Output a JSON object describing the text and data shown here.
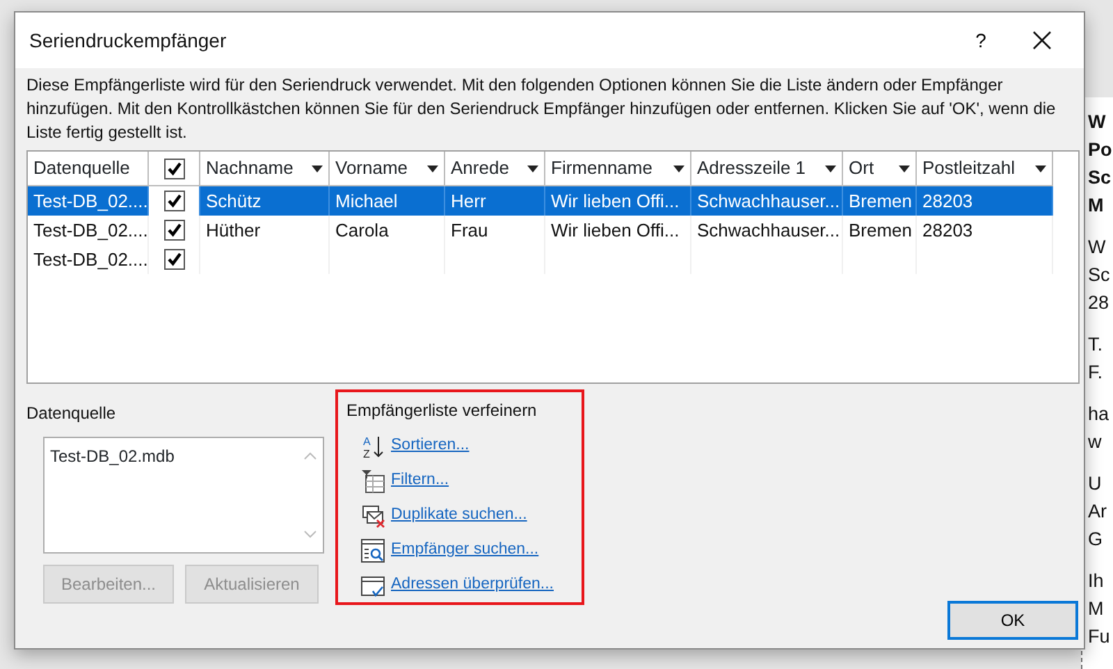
{
  "window": {
    "title": "Seriendruckempfänger",
    "help": "?"
  },
  "description": "Diese Empfängerliste wird für den Seriendruck verwendet. Mit den folgenden Optionen können Sie die Liste ändern oder Empfänger hinzufügen. Mit den Kontrollkästchen können Sie für den Seriendruck Empfänger hinzufügen oder entfernen. Klicken Sie auf 'OK', wenn die Liste fertig gestellt ist.",
  "table": {
    "columns": [
      {
        "label": "Datenquelle",
        "kind": "text"
      },
      {
        "label": "Nachname",
        "kind": "filter"
      },
      {
        "label": "Vorname",
        "kind": "filter"
      },
      {
        "label": "Anrede",
        "kind": "filter"
      },
      {
        "label": "Firmenname",
        "kind": "filter"
      },
      {
        "label": "Adresszeile 1",
        "kind": "filter"
      },
      {
        "label": "Ort",
        "kind": "filter"
      },
      {
        "label": "Postleitzahl",
        "kind": "filter"
      }
    ],
    "check_column": {
      "checked": true
    },
    "rows": [
      {
        "selected": true,
        "checked": true,
        "cells": [
          "Test-DB_02....",
          "Schütz",
          "Michael",
          "Herr",
          "Wir lieben Offi...",
          "Schwachhauser...",
          "Bremen",
          "28203"
        ]
      },
      {
        "selected": false,
        "checked": true,
        "cells": [
          "Test-DB_02....",
          "Hüther",
          "Carola",
          "Frau",
          "Wir lieben Offi...",
          "Schwachhauser...",
          "Bremen",
          "28203"
        ]
      },
      {
        "selected": false,
        "checked": true,
        "cells": [
          "Test-DB_02....",
          "",
          "",
          "",
          "",
          "",
          "",
          ""
        ]
      }
    ]
  },
  "data_source": {
    "label": "Datenquelle",
    "items": [
      "Test-DB_02.mdb"
    ],
    "buttons": [
      {
        "label": "Bearbeiten...",
        "disabled": true
      },
      {
        "label": "Aktualisieren",
        "disabled": true
      }
    ]
  },
  "refine": {
    "label": "Empfängerliste verfeinern",
    "links": [
      {
        "kind": "sort",
        "label": "Sortieren...",
        "icon_letters": [
          "A",
          "Z"
        ]
      },
      {
        "kind": "filter",
        "label": "Filtern..."
      },
      {
        "kind": "duplicates",
        "label": "Duplikate suchen..."
      },
      {
        "kind": "find",
        "label": "Empfänger suchen..."
      },
      {
        "kind": "validate",
        "label": "Adressen überprüfen..."
      }
    ]
  },
  "ok_button": "OK",
  "document_fragments": [
    {
      "bold": true,
      "lines": [
        "W",
        "Po",
        "Sc",
        "M"
      ]
    },
    {
      "bold": false,
      "lines": [
        "W",
        "Sc",
        "28"
      ]
    },
    {
      "bold": false,
      "lines": [
        "T.",
        "F."
      ]
    },
    {
      "bold": false,
      "lines": [
        "ha",
        "w"
      ]
    },
    {
      "bold": false,
      "lines": [
        "U",
        "Ar",
        "G"
      ]
    },
    {
      "bold": false,
      "lines": [
        "Ih",
        "M",
        "Fu"
      ]
    }
  ]
}
